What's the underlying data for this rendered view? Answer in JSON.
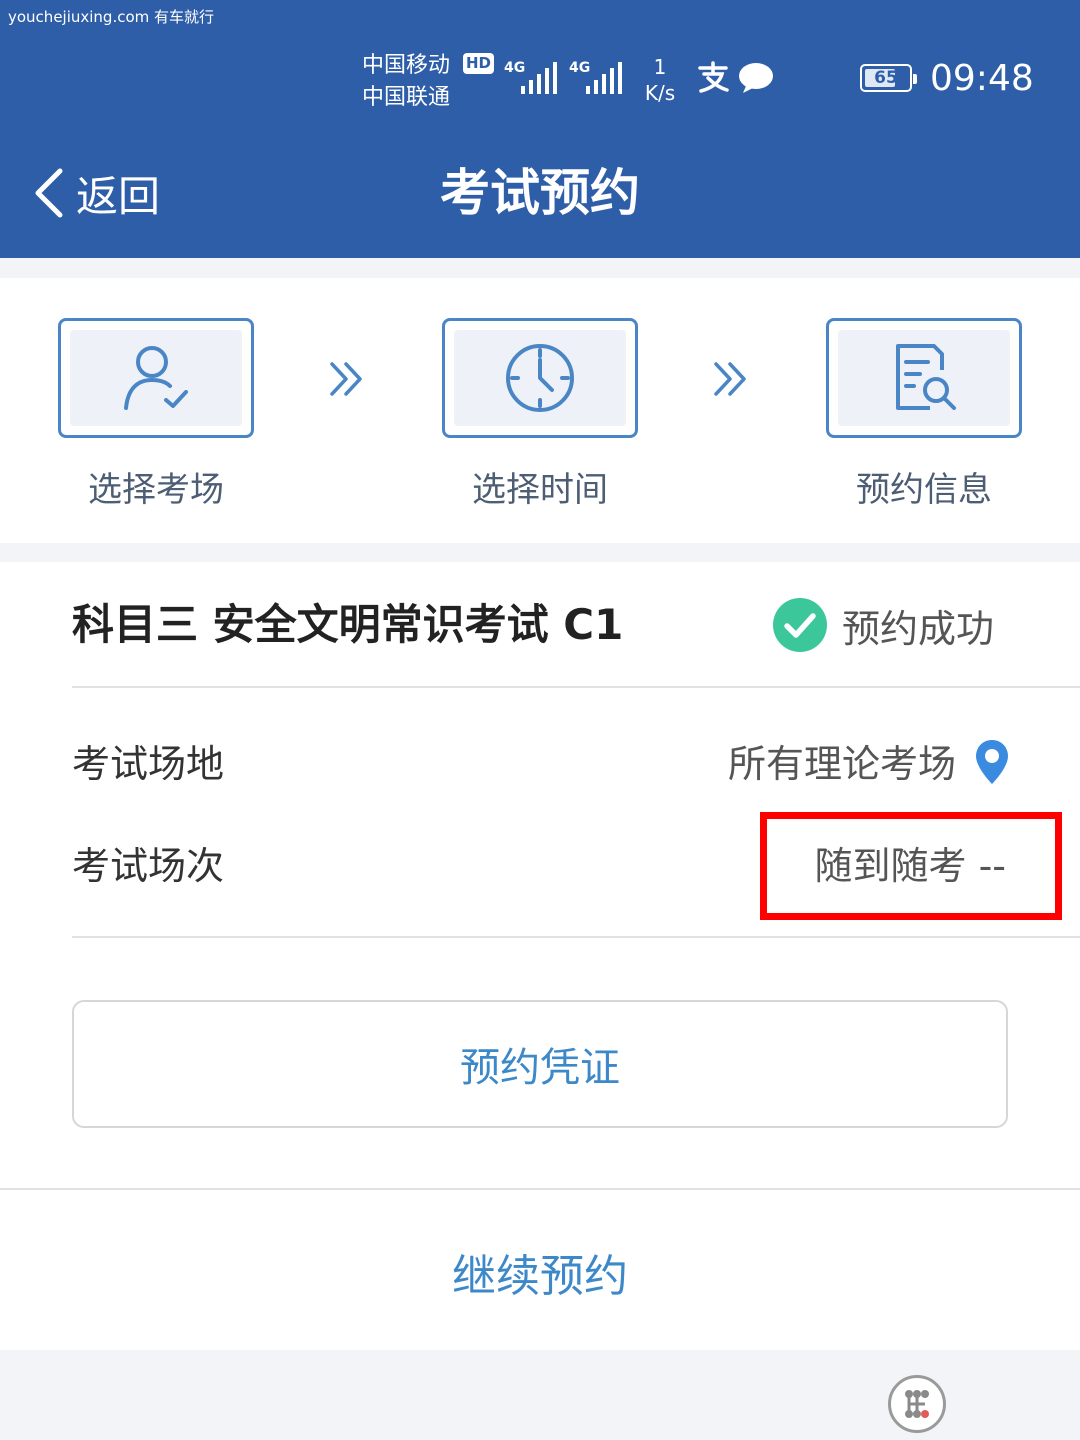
{
  "watermark": "youchejiuxing.com 有车就行",
  "status_bar": {
    "carrier_primary": "中国移动",
    "carrier_secondary": "中国联通",
    "hd_badge": "HD",
    "network_type": "4G",
    "speed_value": "1",
    "speed_unit": "K/s",
    "battery_level": "65",
    "time": "09:48"
  },
  "nav": {
    "back_label": "返回",
    "title": "考试预约"
  },
  "steps": [
    {
      "label": "选择考场",
      "icon": "user-check-icon"
    },
    {
      "label": "选择时间",
      "icon": "clock-icon"
    },
    {
      "label": "预约信息",
      "icon": "document-search-icon"
    }
  ],
  "result": {
    "exam_title": "科目三 安全文明常识考试 C1",
    "status": "预约成功",
    "rows": [
      {
        "label": "考试场地",
        "value": "所有理论考场"
      },
      {
        "label": "考试场次",
        "value": "随到随考 --"
      }
    ],
    "voucher_button": "预约凭证",
    "continue_button": "继续预约"
  },
  "colors": {
    "header": "#2f5ea9",
    "accent": "#3c88c9",
    "success": "#3cc79a",
    "highlight": "#ff0000"
  }
}
